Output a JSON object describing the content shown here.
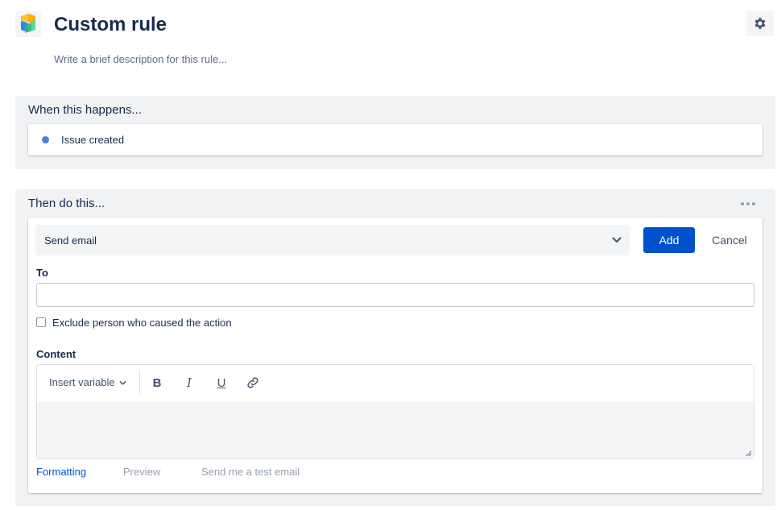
{
  "header": {
    "title": "Custom rule",
    "description_placeholder": "Write a brief description for this rule..."
  },
  "when_section": {
    "heading": "When this happens...",
    "trigger": {
      "label": "Issue created",
      "dot_color": "#4a7fde"
    }
  },
  "then_section": {
    "heading": "Then do this...",
    "action": {
      "selected": "Send email",
      "add_label": "Add",
      "cancel_label": "Cancel"
    },
    "to": {
      "label": "To",
      "value": ""
    },
    "exclude": {
      "label": "Exclude person who caused the action",
      "checked": false
    },
    "content": {
      "label": "Content",
      "toolbar": {
        "insert_variable": "Insert variable",
        "bold": "B",
        "italic": "I",
        "underline": "U"
      },
      "value": ""
    },
    "footer": {
      "formatting": "Formatting",
      "preview": "Preview",
      "test_email": "Send me a test email"
    }
  },
  "icons": {
    "app": "jira-automation-cube-icon",
    "settings": "gear-icon",
    "more": "more-horizontal-icon",
    "select": "chevron-down-icon",
    "link": "link-icon"
  },
  "colors": {
    "primary": "#0052cc",
    "section_bg": "#f1f2f4",
    "text": "#172b4d",
    "muted": "#97a0af"
  }
}
